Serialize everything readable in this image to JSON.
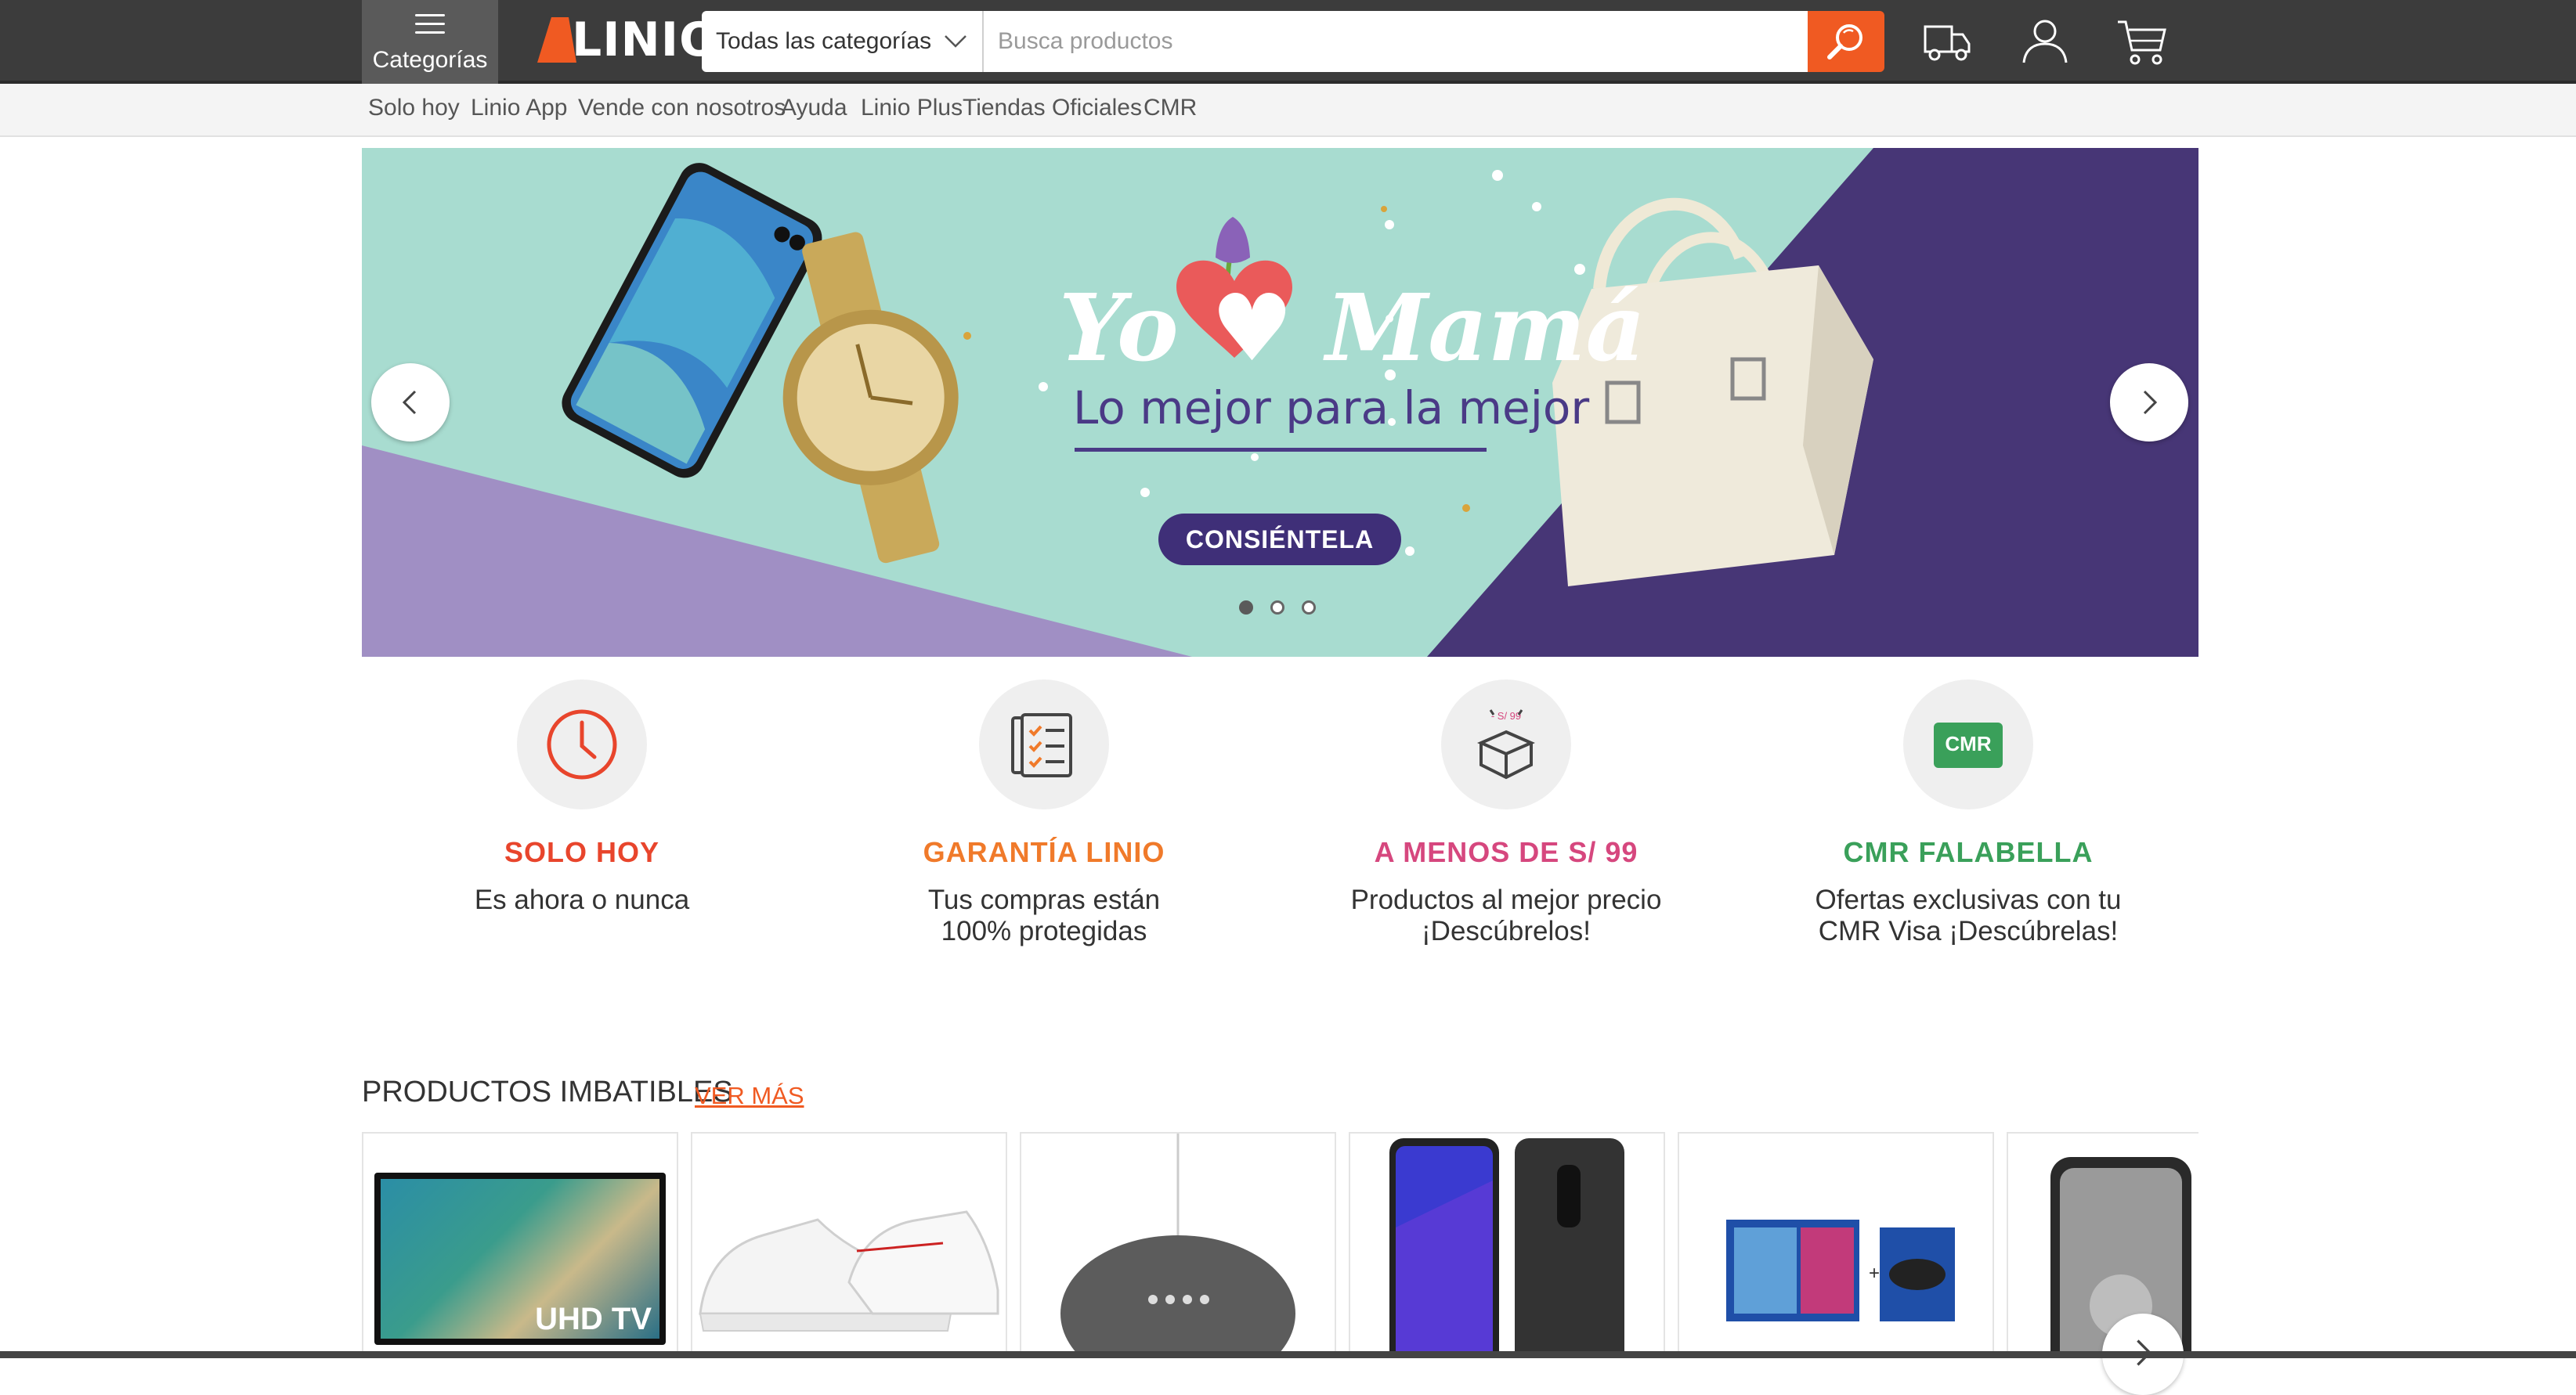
{
  "header": {
    "categories_label": "Categorías",
    "logo_text": "LINIO",
    "category_select": "Todas las categorías",
    "search_placeholder": "Busca productos"
  },
  "subnav": [
    "Solo hoy",
    "Linio App",
    "Vende con nosotros",
    "Ayuda",
    "Linio Plus",
    "Tiendas Oficiales",
    "CMR"
  ],
  "banner": {
    "title": "Yo ♥ Mamá",
    "subtitle": "Lo mejor para la mejor",
    "cta": "CONSIÉNTELA",
    "slides": 3,
    "active_slide": 1,
    "colors": {
      "mint": "#a8dcd0",
      "purple_dark": "#3f2f78",
      "lavender": "#a08fc4"
    }
  },
  "features": [
    {
      "title": "SOLO HOY",
      "desc": "Es ahora o nunca",
      "color": "#e8452c",
      "icon": "clock-icon"
    },
    {
      "title": "GARANTÍA LINIO",
      "desc": "Tus compras están 100% protegidas",
      "color": "#f07a2a",
      "icon": "checklist-icon"
    },
    {
      "title": "A MENOS DE S/ 99",
      "desc": "Productos al mejor precio ¡Descúbrelos!",
      "color": "#d6477e",
      "icon": "box-icon",
      "icon_label": "- S/ 99"
    },
    {
      "title": "CMR FALABELLA",
      "desc": "Ofertas exclusivas con tu CMR Visa ¡Descúbrelas!",
      "color": "#3aa05a",
      "icon": "cmr-card-icon",
      "icon_label": "CMR"
    }
  ],
  "products": {
    "title": "PRODUCTOS IMBATIBLES",
    "ver_mas": "VER MÁS",
    "items": [
      {
        "name": "tv",
        "label": "UHD TV"
      },
      {
        "name": "sneakers"
      },
      {
        "name": "smart-speaker"
      },
      {
        "name": "smartphone"
      },
      {
        "name": "game-console"
      },
      {
        "name": "smartphone-2"
      }
    ]
  },
  "brand_color": "#f05a22"
}
